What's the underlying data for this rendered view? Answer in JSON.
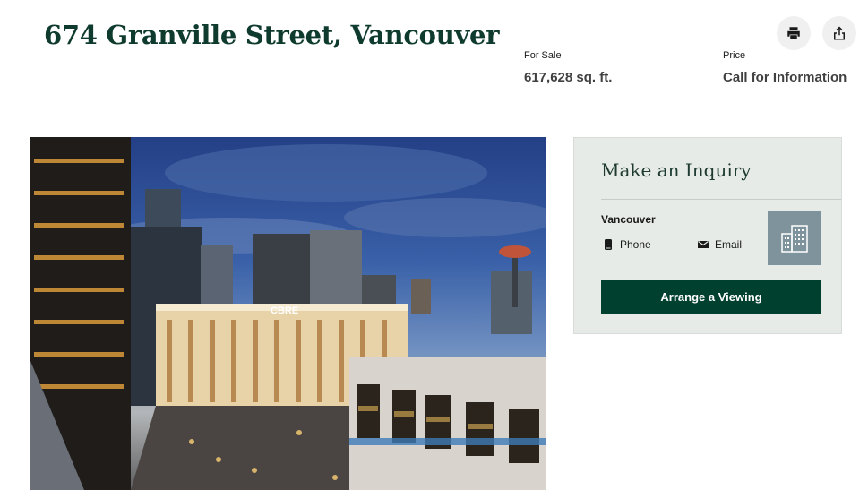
{
  "listing": {
    "title": "674 Granville Street, Vancouver",
    "for_sale_label": "For Sale",
    "area": "617,628 sq. ft.",
    "price_label": "Price",
    "price_value": "Call for Information"
  },
  "actions": {
    "print_icon": "print-icon",
    "share_icon": "share-icon"
  },
  "photo": {
    "sign_text": "CBRE"
  },
  "inquiry": {
    "title": "Make an Inquiry",
    "office": "Vancouver",
    "phone_label": "Phone",
    "email_label": "Email",
    "office_icon": "building-icon",
    "cta_label": "Arrange a Viewing"
  },
  "colors": {
    "brand_green": "#00402f",
    "title_green": "#0f3b2e",
    "panel_bg": "#e6ebe8",
    "badge_bg": "#7e939b"
  }
}
